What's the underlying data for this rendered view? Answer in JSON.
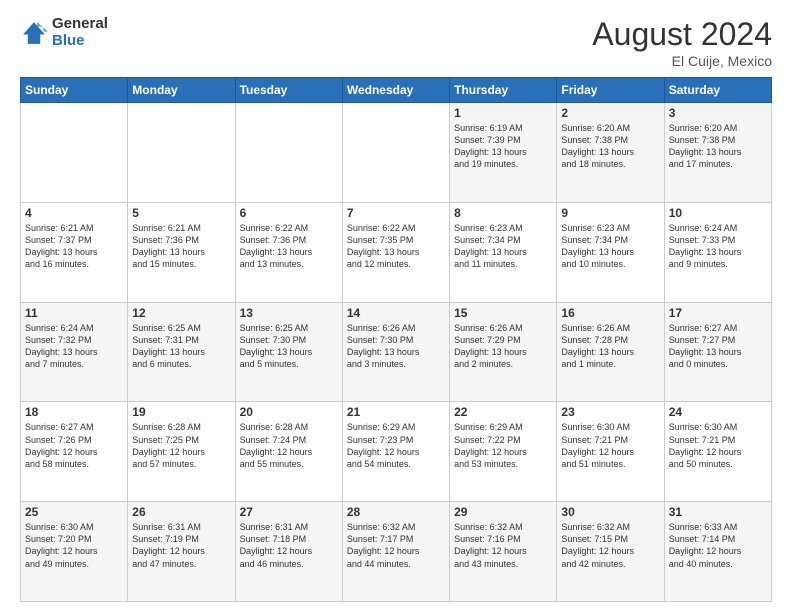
{
  "header": {
    "logo_general": "General",
    "logo_blue": "Blue",
    "month_title": "August 2024",
    "location": "El Cuije, Mexico"
  },
  "weekdays": [
    "Sunday",
    "Monday",
    "Tuesday",
    "Wednesday",
    "Thursday",
    "Friday",
    "Saturday"
  ],
  "weeks": [
    [
      {
        "day": "",
        "info": ""
      },
      {
        "day": "",
        "info": ""
      },
      {
        "day": "",
        "info": ""
      },
      {
        "day": "",
        "info": ""
      },
      {
        "day": "1",
        "info": "Sunrise: 6:19 AM\nSunset: 7:39 PM\nDaylight: 13 hours\nand 19 minutes."
      },
      {
        "day": "2",
        "info": "Sunrise: 6:20 AM\nSunset: 7:38 PM\nDaylight: 13 hours\nand 18 minutes."
      },
      {
        "day": "3",
        "info": "Sunrise: 6:20 AM\nSunset: 7:38 PM\nDaylight: 13 hours\nand 17 minutes."
      }
    ],
    [
      {
        "day": "4",
        "info": "Sunrise: 6:21 AM\nSunset: 7:37 PM\nDaylight: 13 hours\nand 16 minutes."
      },
      {
        "day": "5",
        "info": "Sunrise: 6:21 AM\nSunset: 7:36 PM\nDaylight: 13 hours\nand 15 minutes."
      },
      {
        "day": "6",
        "info": "Sunrise: 6:22 AM\nSunset: 7:36 PM\nDaylight: 13 hours\nand 13 minutes."
      },
      {
        "day": "7",
        "info": "Sunrise: 6:22 AM\nSunset: 7:35 PM\nDaylight: 13 hours\nand 12 minutes."
      },
      {
        "day": "8",
        "info": "Sunrise: 6:23 AM\nSunset: 7:34 PM\nDaylight: 13 hours\nand 11 minutes."
      },
      {
        "day": "9",
        "info": "Sunrise: 6:23 AM\nSunset: 7:34 PM\nDaylight: 13 hours\nand 10 minutes."
      },
      {
        "day": "10",
        "info": "Sunrise: 6:24 AM\nSunset: 7:33 PM\nDaylight: 13 hours\nand 9 minutes."
      }
    ],
    [
      {
        "day": "11",
        "info": "Sunrise: 6:24 AM\nSunset: 7:32 PM\nDaylight: 13 hours\nand 7 minutes."
      },
      {
        "day": "12",
        "info": "Sunrise: 6:25 AM\nSunset: 7:31 PM\nDaylight: 13 hours\nand 6 minutes."
      },
      {
        "day": "13",
        "info": "Sunrise: 6:25 AM\nSunset: 7:30 PM\nDaylight: 13 hours\nand 5 minutes."
      },
      {
        "day": "14",
        "info": "Sunrise: 6:26 AM\nSunset: 7:30 PM\nDaylight: 13 hours\nand 3 minutes."
      },
      {
        "day": "15",
        "info": "Sunrise: 6:26 AM\nSunset: 7:29 PM\nDaylight: 13 hours\nand 2 minutes."
      },
      {
        "day": "16",
        "info": "Sunrise: 6:26 AM\nSunset: 7:28 PM\nDaylight: 13 hours\nand 1 minute."
      },
      {
        "day": "17",
        "info": "Sunrise: 6:27 AM\nSunset: 7:27 PM\nDaylight: 13 hours\nand 0 minutes."
      }
    ],
    [
      {
        "day": "18",
        "info": "Sunrise: 6:27 AM\nSunset: 7:26 PM\nDaylight: 12 hours\nand 58 minutes."
      },
      {
        "day": "19",
        "info": "Sunrise: 6:28 AM\nSunset: 7:25 PM\nDaylight: 12 hours\nand 57 minutes."
      },
      {
        "day": "20",
        "info": "Sunrise: 6:28 AM\nSunset: 7:24 PM\nDaylight: 12 hours\nand 55 minutes."
      },
      {
        "day": "21",
        "info": "Sunrise: 6:29 AM\nSunset: 7:23 PM\nDaylight: 12 hours\nand 54 minutes."
      },
      {
        "day": "22",
        "info": "Sunrise: 6:29 AM\nSunset: 7:22 PM\nDaylight: 12 hours\nand 53 minutes."
      },
      {
        "day": "23",
        "info": "Sunrise: 6:30 AM\nSunset: 7:21 PM\nDaylight: 12 hours\nand 51 minutes."
      },
      {
        "day": "24",
        "info": "Sunrise: 6:30 AM\nSunset: 7:21 PM\nDaylight: 12 hours\nand 50 minutes."
      }
    ],
    [
      {
        "day": "25",
        "info": "Sunrise: 6:30 AM\nSunset: 7:20 PM\nDaylight: 12 hours\nand 49 minutes."
      },
      {
        "day": "26",
        "info": "Sunrise: 6:31 AM\nSunset: 7:19 PM\nDaylight: 12 hours\nand 47 minutes."
      },
      {
        "day": "27",
        "info": "Sunrise: 6:31 AM\nSunset: 7:18 PM\nDaylight: 12 hours\nand 46 minutes."
      },
      {
        "day": "28",
        "info": "Sunrise: 6:32 AM\nSunset: 7:17 PM\nDaylight: 12 hours\nand 44 minutes."
      },
      {
        "day": "29",
        "info": "Sunrise: 6:32 AM\nSunset: 7:16 PM\nDaylight: 12 hours\nand 43 minutes."
      },
      {
        "day": "30",
        "info": "Sunrise: 6:32 AM\nSunset: 7:15 PM\nDaylight: 12 hours\nand 42 minutes."
      },
      {
        "day": "31",
        "info": "Sunrise: 6:33 AM\nSunset: 7:14 PM\nDaylight: 12 hours\nand 40 minutes."
      }
    ]
  ]
}
